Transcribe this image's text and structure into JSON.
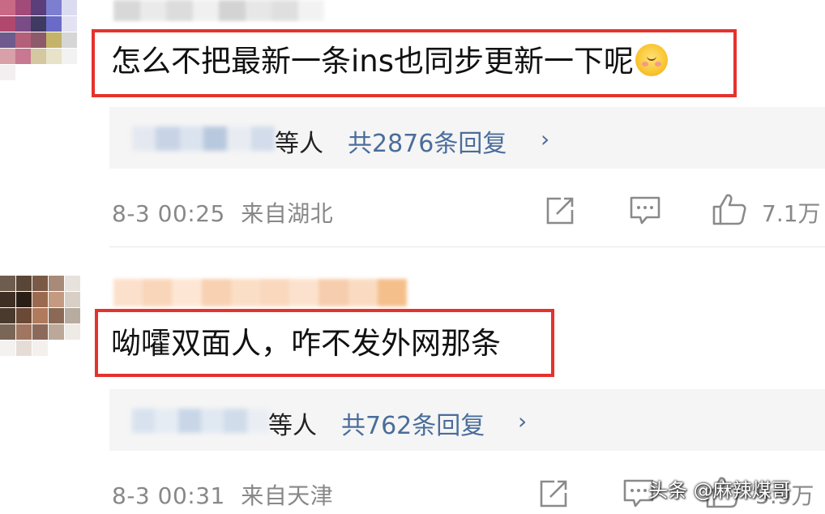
{
  "comments": [
    {
      "text": "怎么不把最新一条ins也同步更新一下呢",
      "emoji": "blush-face-emoji",
      "reply_users": "等人",
      "reply_count": "共2876条回复",
      "reply_chevron": "›",
      "time": "8-3 00:25",
      "location": "来自湖北",
      "likes": "7.1万"
    },
    {
      "text": "呦嚯双面人，咋不发外网那条",
      "reply_users": "等人",
      "reply_count": "共762条回复",
      "reply_chevron": "›",
      "time": "8-3 00:31",
      "location": "来自天津",
      "likes": "5.9万"
    }
  ],
  "watermark": "头条 @麻辣煤哥",
  "colors": {
    "highlight_border": "#e5322d",
    "link": "#4a6d9a",
    "meta_gray": "#888888",
    "reply_bg": "#f5f5f5"
  },
  "icons": [
    "share-icon",
    "comment-icon",
    "like-thumb-icon"
  ]
}
